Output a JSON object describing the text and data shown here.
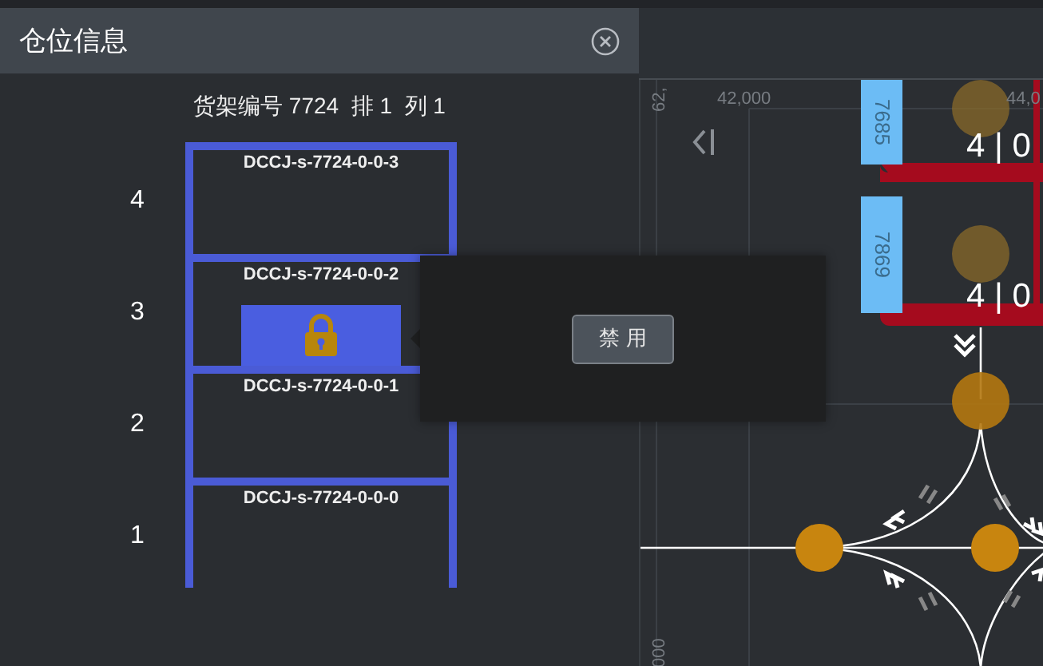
{
  "panel": {
    "title": "仓位信息",
    "heading": "货架编号 7724  排 1  列 1",
    "levels": [
      {
        "number": "4",
        "code": "DCCJ-s-7724-0-0-3",
        "locked": false
      },
      {
        "number": "3",
        "code": "DCCJ-s-7724-0-0-2",
        "locked": true
      },
      {
        "number": "2",
        "code": "DCCJ-s-7724-0-0-1",
        "locked": false
      },
      {
        "number": "1",
        "code": "DCCJ-s-7724-0-0-0",
        "locked": false
      }
    ]
  },
  "popup": {
    "button": "禁用"
  },
  "map": {
    "axis_labels": [
      "42,000",
      "44,0"
    ],
    "vertical_axis_labels": [
      "62,",
      "000"
    ],
    "racks": [
      {
        "label": "7685",
        "reading": "4 | 0"
      },
      {
        "label": "7869",
        "reading": "4 | 0"
      }
    ]
  }
}
